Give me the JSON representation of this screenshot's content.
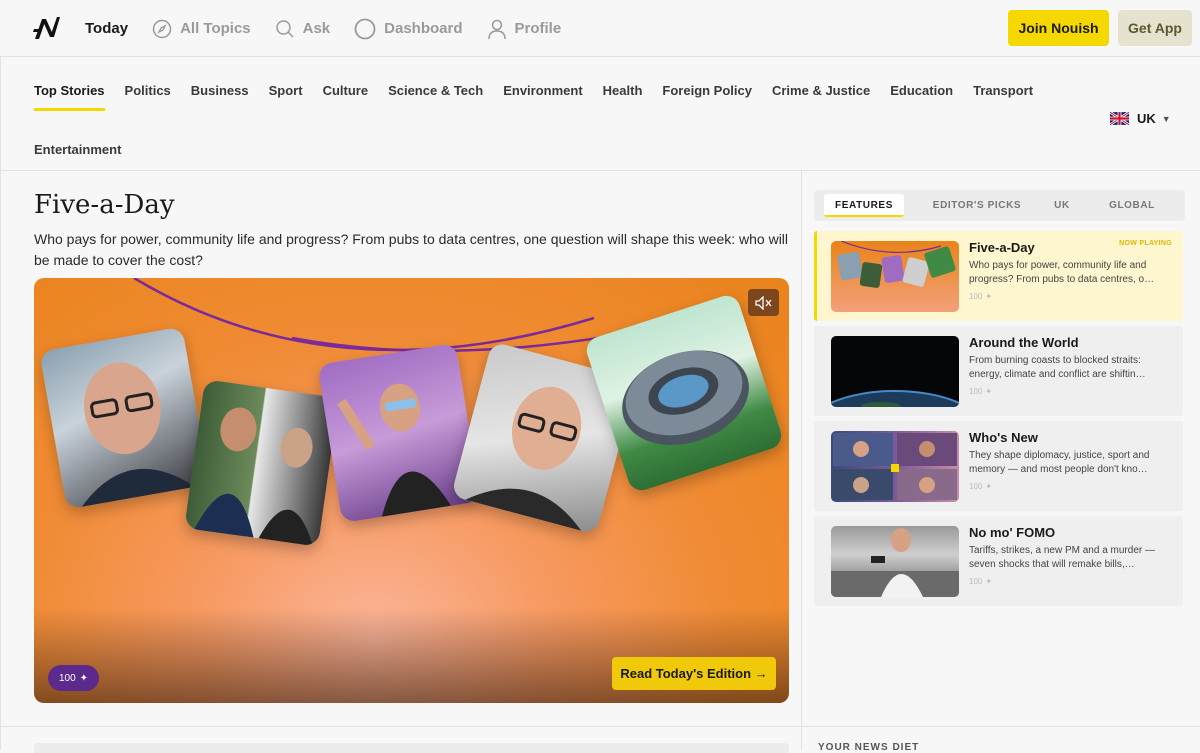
{
  "header": {
    "nav": [
      {
        "label": "Today",
        "icon": "none"
      },
      {
        "label": "All Topics",
        "icon": "compass-icon"
      },
      {
        "label": "Ask",
        "icon": "search-icon"
      },
      {
        "label": "Dashboard",
        "icon": "circle-icon"
      },
      {
        "label": "Profile",
        "icon": "user-icon"
      }
    ],
    "join_label": "Join Nouish",
    "app_label": "Get App"
  },
  "categories": [
    "Top Stories",
    "Politics",
    "Business",
    "Sport",
    "Culture",
    "Science & Tech",
    "Environment",
    "Health",
    "Foreign Policy",
    "Crime & Justice",
    "Education",
    "Transport"
  ],
  "category_overflow": "Entertainment",
  "region": {
    "label": "UK",
    "flag": "uk-flag-icon"
  },
  "hero": {
    "title": "Five-a-Day",
    "subtitle": "Who pays for power, community life and progress? From pubs to data centres, one question will shape this week: who will be made to cover the cost?",
    "score": "100",
    "cta": "Read Today's Edition →"
  },
  "side": {
    "tabs": [
      "FEATURES",
      "EDITOR'S PICKS",
      "UK",
      "GLOBAL"
    ],
    "now_playing": "NOW PLAYING",
    "cards": [
      {
        "title": "Five-a-Day",
        "desc": "Who pays for power, community life and progress? From pubs to data centres, o…",
        "score": "100"
      },
      {
        "title": "Around the World",
        "desc": "From burning coasts to blocked straits: energy, climate and conflict are shiftin…",
        "score": "100"
      },
      {
        "title": "Who's New",
        "desc": "They shape diplomacy, justice, sport and memory — and most people don't kno…",
        "score": "100"
      },
      {
        "title": "No mo' FOMO",
        "desc": "Tariffs, strikes, a new PM and a murder — seven shocks that will remake bills,…",
        "score": "100"
      }
    ]
  },
  "bottom": {
    "diet_label": "YOUR NEWS DIET"
  },
  "colors": {
    "accent": "#f5d800",
    "score_pill": "#5b2a8c",
    "hero_orange": "#f08b34"
  }
}
